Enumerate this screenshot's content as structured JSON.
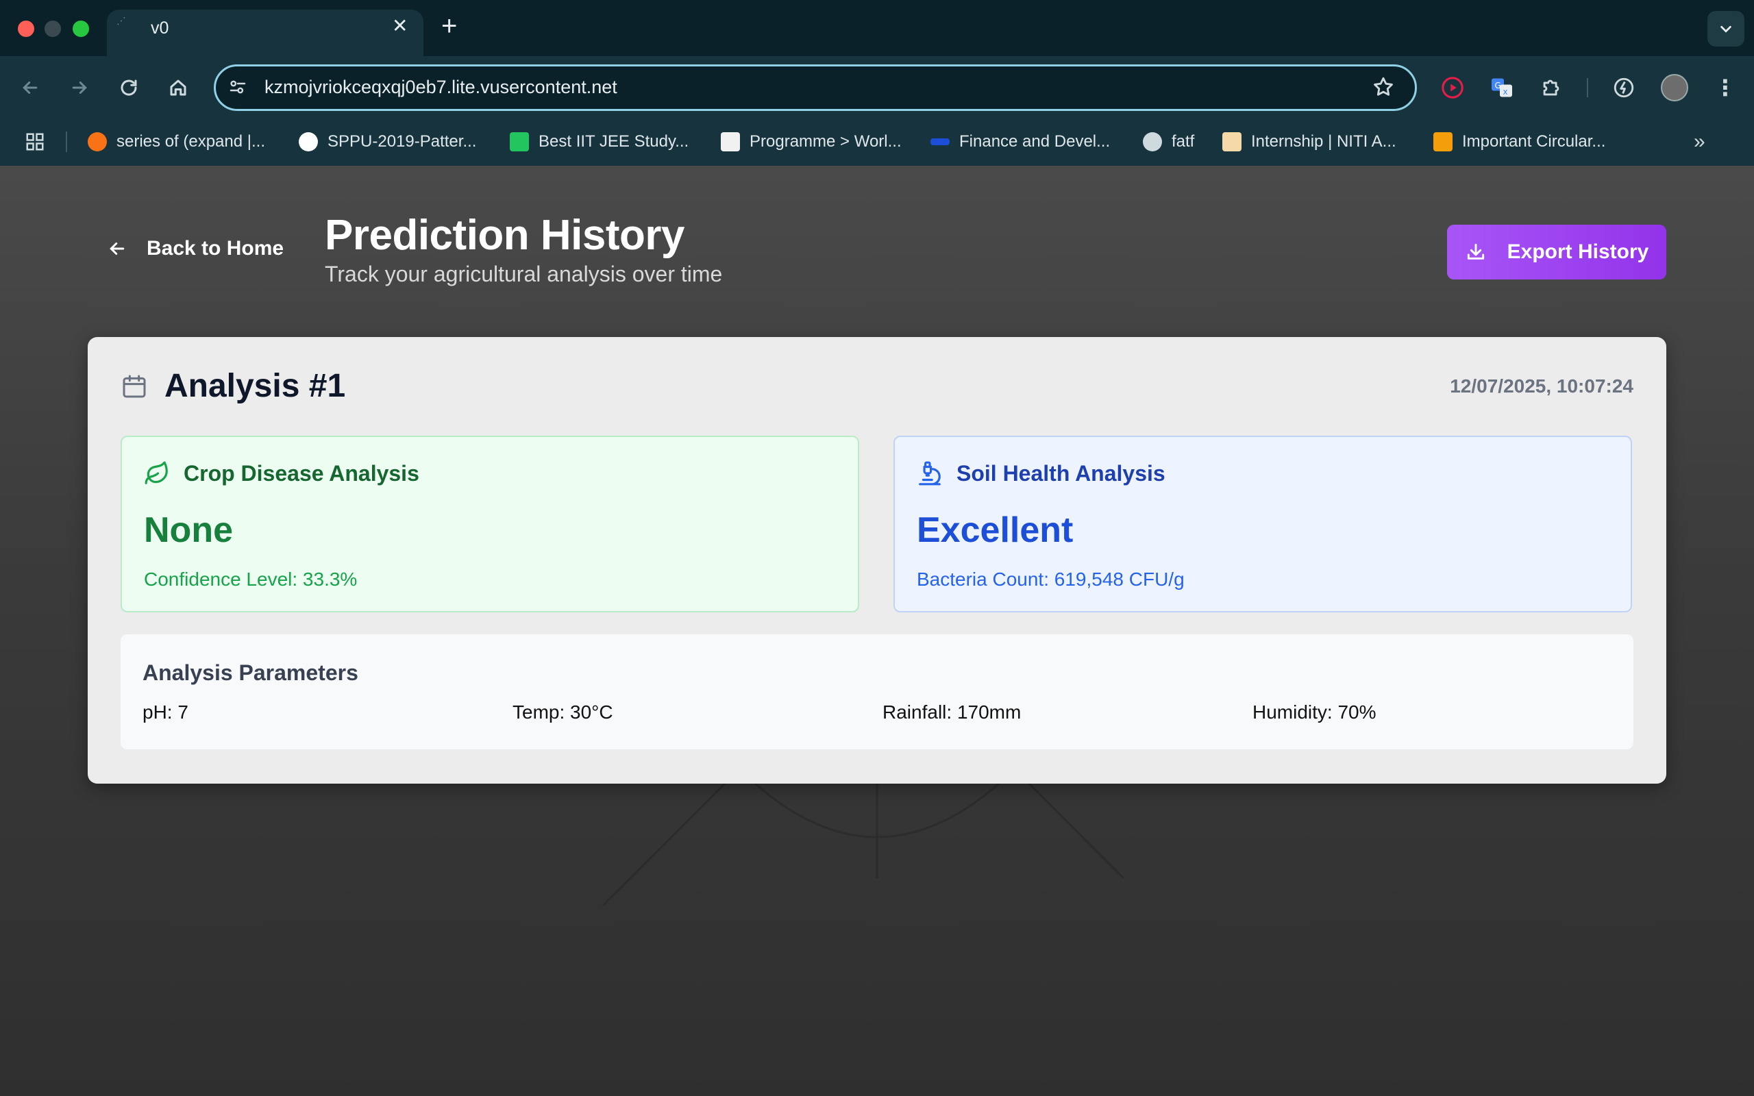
{
  "browser": {
    "tab_title": "v0",
    "url": "kzmojvriokceqxqj0eb7.lite.vusercontent.net",
    "bookmarks": [
      {
        "label": "series of (expand |...",
        "icon": "gear-orange-icon",
        "color": "#f97316"
      },
      {
        "label": "SPPU-2019-Patter...",
        "icon": "github-icon",
        "color": "#ffffff"
      },
      {
        "label": "Best IIT JEE Study...",
        "icon": "green-plus-icon",
        "color": "#22c55e"
      },
      {
        "label": "Programme > Worl...",
        "icon": "document-icon",
        "color": "#f1f1f1"
      },
      {
        "label": "Finance and Devel...",
        "icon": "imf-icon",
        "color": "#1d4ed8"
      },
      {
        "label": "fatf",
        "icon": "globe-icon",
        "color": "#cfdade"
      },
      {
        "label": "Internship | NITI A...",
        "icon": "niti-icon",
        "color": "#f5d9a8"
      },
      {
        "label": "Important Circular...",
        "icon": "building-icon",
        "color": "#f59e0b"
      }
    ]
  },
  "header": {
    "back_label": "Back to Home",
    "title": "Prediction History",
    "subtitle": "Track your agricultural analysis over time",
    "export_label": "Export History"
  },
  "analysis": {
    "title": "Analysis #1",
    "timestamp": "12/07/2025, 10:07:24",
    "crop": {
      "heading": "Crop Disease Analysis",
      "result": "None",
      "confidence": "Confidence Level: 33.3%"
    },
    "soil": {
      "heading": "Soil Health Analysis",
      "result": "Excellent",
      "bacteria": "Bacteria Count: 619,548 CFU/g"
    },
    "parameters": {
      "heading": "Analysis Parameters",
      "ph": "pH: 7",
      "temp": "Temp: 30°C",
      "rainfall": "Rainfall: 170mm",
      "humidity": "Humidity: 70%"
    }
  },
  "colors": {
    "accent_purple": "#a855f7",
    "crop_green": "#16803c",
    "soil_blue": "#1d4ed8"
  }
}
